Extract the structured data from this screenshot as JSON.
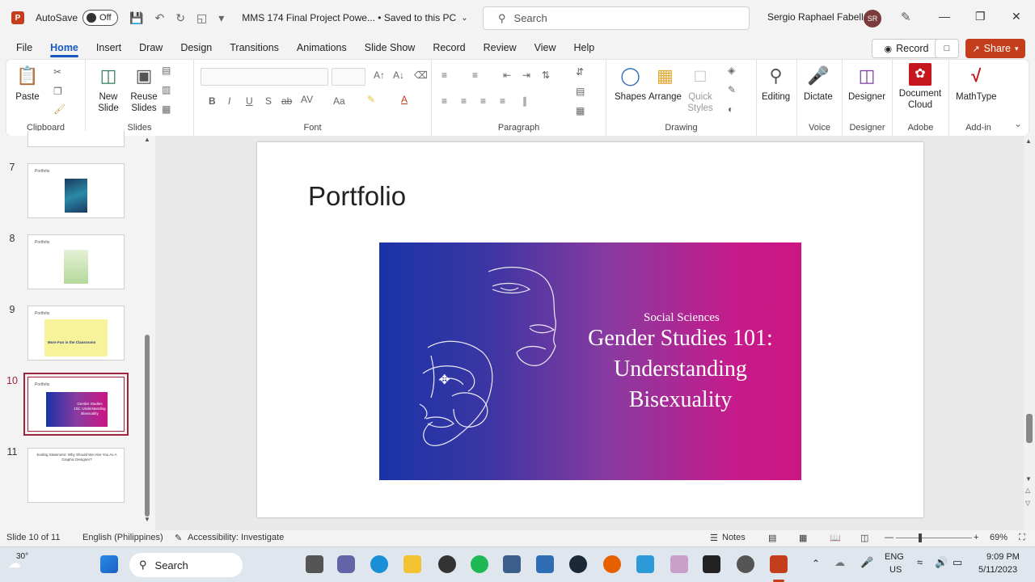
{
  "titlebar": {
    "autosave_label": "AutoSave",
    "autosave_state": "Off",
    "doc_title": "MMS 174 Final Project Powe...  •  Saved to this PC",
    "search_placeholder": "Search",
    "user_name": "Sergio Raphael Fabella",
    "user_initials": "SR"
  },
  "tabs": [
    "File",
    "Home",
    "Insert",
    "Draw",
    "Design",
    "Transitions",
    "Animations",
    "Slide Show",
    "Record",
    "Review",
    "View",
    "Help"
  ],
  "actions": {
    "record": "Record",
    "share": "Share"
  },
  "ribbon": {
    "clipboard": {
      "paste": "Paste",
      "label": "Clipboard"
    },
    "slides": {
      "new_slide": "New Slide",
      "reuse_slides": "Reuse Slides",
      "label": "Slides"
    },
    "font": {
      "label": "Font"
    },
    "paragraph": {
      "label": "Paragraph"
    },
    "drawing": {
      "shapes": "Shapes",
      "arrange": "Arrange",
      "quick_styles": "Quick Styles",
      "label": "Drawing"
    },
    "editing": {
      "label": "Editing"
    },
    "voice": {
      "dictate": "Dictate",
      "label": "Voice"
    },
    "designer": {
      "designer": "Designer",
      "label": "Designer"
    },
    "adobe": {
      "document_cloud": "Document Cloud",
      "label": "Adobe"
    },
    "addin": {
      "mathtype": "MathType",
      "label": "Add-in"
    }
  },
  "thumbnails": [
    {
      "num": "7",
      "title": "Portfolio"
    },
    {
      "num": "8",
      "title": "Portfolio"
    },
    {
      "num": "9",
      "title": "Portfolio",
      "caption": "More Fun in the Classroom!"
    },
    {
      "num": "10",
      "title": "Portfolio",
      "caption": "Gender Studies 101: Understanding Bisexuality"
    },
    {
      "num": "11",
      "title": "Ending Statement: Why Should We Hire You As A Graphic Designer?"
    }
  ],
  "slide": {
    "title": "Portfolio",
    "image": {
      "category": "Social Sciences",
      "headline_1": "Gender Studies 101:",
      "headline_2": "Understanding",
      "headline_3": "Bisexuality"
    }
  },
  "status": {
    "slide_info": "Slide 10 of 11",
    "language": "English (Philippines)",
    "accessibility": "Accessibility: Investigate",
    "notes": "Notes",
    "zoom": "69%"
  },
  "taskbar": {
    "weather": "30°",
    "search": "Search",
    "lang_1": "ENG",
    "lang_2": "US",
    "time": "9:09 PM",
    "date": "5/11/2023"
  }
}
